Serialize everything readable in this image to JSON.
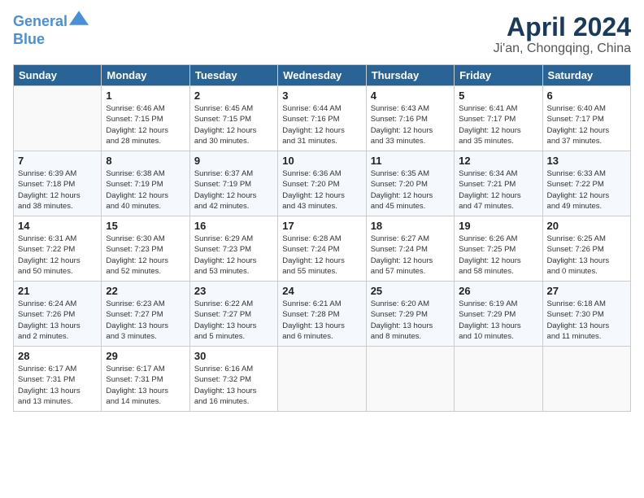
{
  "header": {
    "logo_line1": "General",
    "logo_line2": "Blue",
    "title": "April 2024",
    "subtitle": "Ji'an, Chongqing, China"
  },
  "weekdays": [
    "Sunday",
    "Monday",
    "Tuesday",
    "Wednesday",
    "Thursday",
    "Friday",
    "Saturday"
  ],
  "weeks": [
    [
      {
        "day": "",
        "info": ""
      },
      {
        "day": "1",
        "info": "Sunrise: 6:46 AM\nSunset: 7:15 PM\nDaylight: 12 hours\nand 28 minutes."
      },
      {
        "day": "2",
        "info": "Sunrise: 6:45 AM\nSunset: 7:15 PM\nDaylight: 12 hours\nand 30 minutes."
      },
      {
        "day": "3",
        "info": "Sunrise: 6:44 AM\nSunset: 7:16 PM\nDaylight: 12 hours\nand 31 minutes."
      },
      {
        "day": "4",
        "info": "Sunrise: 6:43 AM\nSunset: 7:16 PM\nDaylight: 12 hours\nand 33 minutes."
      },
      {
        "day": "5",
        "info": "Sunrise: 6:41 AM\nSunset: 7:17 PM\nDaylight: 12 hours\nand 35 minutes."
      },
      {
        "day": "6",
        "info": "Sunrise: 6:40 AM\nSunset: 7:17 PM\nDaylight: 12 hours\nand 37 minutes."
      }
    ],
    [
      {
        "day": "7",
        "info": "Sunrise: 6:39 AM\nSunset: 7:18 PM\nDaylight: 12 hours\nand 38 minutes."
      },
      {
        "day": "8",
        "info": "Sunrise: 6:38 AM\nSunset: 7:19 PM\nDaylight: 12 hours\nand 40 minutes."
      },
      {
        "day": "9",
        "info": "Sunrise: 6:37 AM\nSunset: 7:19 PM\nDaylight: 12 hours\nand 42 minutes."
      },
      {
        "day": "10",
        "info": "Sunrise: 6:36 AM\nSunset: 7:20 PM\nDaylight: 12 hours\nand 43 minutes."
      },
      {
        "day": "11",
        "info": "Sunrise: 6:35 AM\nSunset: 7:20 PM\nDaylight: 12 hours\nand 45 minutes."
      },
      {
        "day": "12",
        "info": "Sunrise: 6:34 AM\nSunset: 7:21 PM\nDaylight: 12 hours\nand 47 minutes."
      },
      {
        "day": "13",
        "info": "Sunrise: 6:33 AM\nSunset: 7:22 PM\nDaylight: 12 hours\nand 49 minutes."
      }
    ],
    [
      {
        "day": "14",
        "info": "Sunrise: 6:31 AM\nSunset: 7:22 PM\nDaylight: 12 hours\nand 50 minutes."
      },
      {
        "day": "15",
        "info": "Sunrise: 6:30 AM\nSunset: 7:23 PM\nDaylight: 12 hours\nand 52 minutes."
      },
      {
        "day": "16",
        "info": "Sunrise: 6:29 AM\nSunset: 7:23 PM\nDaylight: 12 hours\nand 53 minutes."
      },
      {
        "day": "17",
        "info": "Sunrise: 6:28 AM\nSunset: 7:24 PM\nDaylight: 12 hours\nand 55 minutes."
      },
      {
        "day": "18",
        "info": "Sunrise: 6:27 AM\nSunset: 7:24 PM\nDaylight: 12 hours\nand 57 minutes."
      },
      {
        "day": "19",
        "info": "Sunrise: 6:26 AM\nSunset: 7:25 PM\nDaylight: 12 hours\nand 58 minutes."
      },
      {
        "day": "20",
        "info": "Sunrise: 6:25 AM\nSunset: 7:26 PM\nDaylight: 13 hours\nand 0 minutes."
      }
    ],
    [
      {
        "day": "21",
        "info": "Sunrise: 6:24 AM\nSunset: 7:26 PM\nDaylight: 13 hours\nand 2 minutes."
      },
      {
        "day": "22",
        "info": "Sunrise: 6:23 AM\nSunset: 7:27 PM\nDaylight: 13 hours\nand 3 minutes."
      },
      {
        "day": "23",
        "info": "Sunrise: 6:22 AM\nSunset: 7:27 PM\nDaylight: 13 hours\nand 5 minutes."
      },
      {
        "day": "24",
        "info": "Sunrise: 6:21 AM\nSunset: 7:28 PM\nDaylight: 13 hours\nand 6 minutes."
      },
      {
        "day": "25",
        "info": "Sunrise: 6:20 AM\nSunset: 7:29 PM\nDaylight: 13 hours\nand 8 minutes."
      },
      {
        "day": "26",
        "info": "Sunrise: 6:19 AM\nSunset: 7:29 PM\nDaylight: 13 hours\nand 10 minutes."
      },
      {
        "day": "27",
        "info": "Sunrise: 6:18 AM\nSunset: 7:30 PM\nDaylight: 13 hours\nand 11 minutes."
      }
    ],
    [
      {
        "day": "28",
        "info": "Sunrise: 6:17 AM\nSunset: 7:31 PM\nDaylight: 13 hours\nand 13 minutes."
      },
      {
        "day": "29",
        "info": "Sunrise: 6:17 AM\nSunset: 7:31 PM\nDaylight: 13 hours\nand 14 minutes."
      },
      {
        "day": "30",
        "info": "Sunrise: 6:16 AM\nSunset: 7:32 PM\nDaylight: 13 hours\nand 16 minutes."
      },
      {
        "day": "",
        "info": ""
      },
      {
        "day": "",
        "info": ""
      },
      {
        "day": "",
        "info": ""
      },
      {
        "day": "",
        "info": ""
      }
    ]
  ]
}
